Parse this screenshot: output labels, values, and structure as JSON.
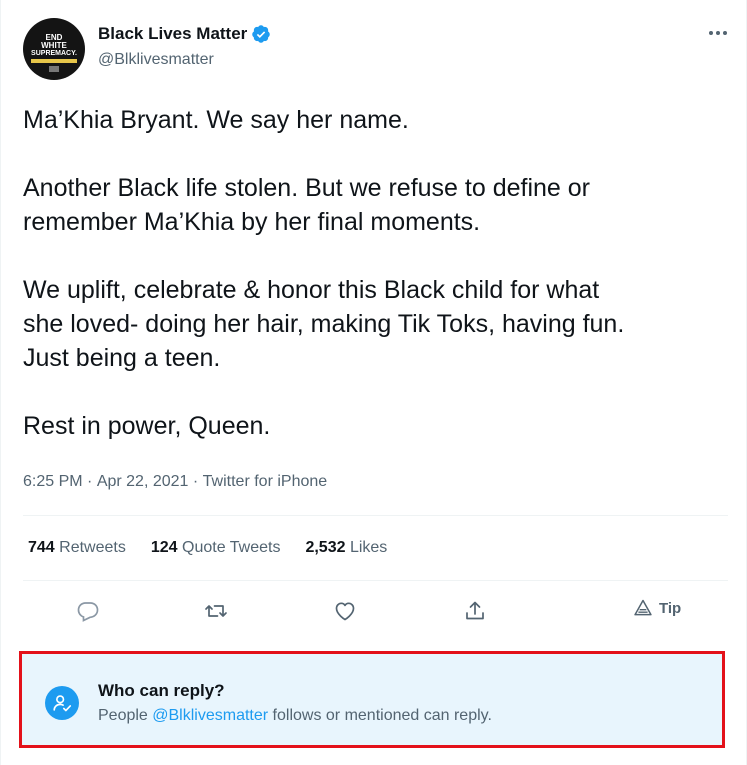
{
  "author": {
    "name": "Black Lives Matter",
    "handle": "@Blklivesmatter",
    "avatar_text": [
      "END",
      "WHITE",
      "SUPREMACY."
    ]
  },
  "tweet": {
    "paragraphs": [
      "Ma’Khia Bryant. We say her name.",
      "Another Black life stolen. But we refuse to define or\nremember Ma’Khia by her final moments.",
      "We uplift, celebrate & honor this Black child for what\nshe loved- doing her hair, making Tik Toks, having fun.\nJust being a teen.",
      "Rest in power, Queen."
    ],
    "time": "6:25 PM",
    "date": "Apr 22, 2021",
    "source": "Twitter for iPhone",
    "separator": " · "
  },
  "stats": {
    "retweets_count": "744",
    "retweets_label": "Retweets",
    "quotes_count": "124",
    "quotes_label": "Quote Tweets",
    "likes_count": "2,532",
    "likes_label": "Likes"
  },
  "actions": {
    "icons": [
      "reply-icon",
      "retweet-icon",
      "like-icon",
      "share-icon",
      "tip-icon"
    ],
    "tip_label": "Tip"
  },
  "who_can_reply": {
    "title": "Who can reply?",
    "prefix": "People ",
    "mention": "@Blklivesmatter",
    "suffix": " follows or mentioned can reply."
  },
  "colors": {
    "accent": "#1d9bf0",
    "text_secondary": "#536471",
    "highlight_border": "#e3111a",
    "reply_box_bg": "#e8f5fd"
  }
}
